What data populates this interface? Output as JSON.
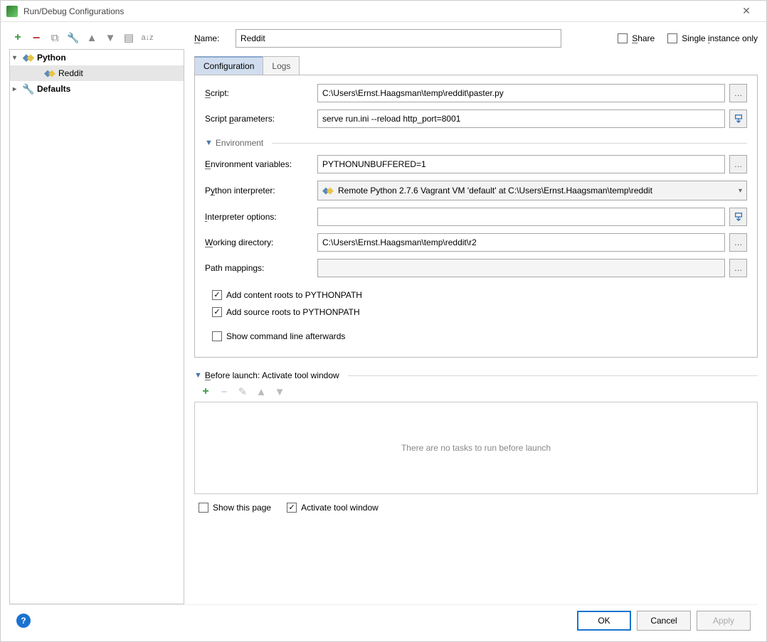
{
  "window": {
    "title": "Run/Debug Configurations"
  },
  "tree": {
    "python": "Python",
    "reddit": "Reddit",
    "defaults": "Defaults"
  },
  "name": {
    "label": "Name:",
    "value": "Reddit"
  },
  "share": {
    "label": "Share",
    "checked": false
  },
  "single": {
    "label": "Single instance only",
    "checked": false
  },
  "tabs": {
    "configuration": "Configuration",
    "logs": "Logs"
  },
  "labels": {
    "script": "Script:",
    "params": "Script parameters:",
    "env_section": "Environment",
    "env_vars": "Environment variables:",
    "interpreter": "Python interpreter:",
    "interp_opts": "Interpreter options:",
    "workdir": "Working directory:",
    "mappings": "Path mappings:",
    "content_roots": "Add content roots to PYTHONPATH",
    "source_roots": "Add source roots to PYTHONPATH",
    "show_cmd": "Show command line afterwards",
    "before": "Before launch: Activate tool window",
    "no_tasks": "There are no tasks to run before launch",
    "show_page": "Show this page",
    "activate_tw": "Activate tool window"
  },
  "values": {
    "script": "C:\\Users\\Ernst.Haagsman\\temp\\reddit\\paster.py",
    "params": "serve run.ini --reload http_port=8001",
    "env_vars": "PYTHONUNBUFFERED=1",
    "interpreter": "Remote Python 2.7.6 Vagrant VM 'default' at C:\\Users\\Ernst.Haagsman\\temp\\reddit",
    "interp_opts": "",
    "workdir": "C:\\Users\\Ernst.Haagsman\\temp\\reddit\\r2",
    "mappings": ""
  },
  "checks": {
    "content_roots": true,
    "source_roots": true,
    "show_cmd": false,
    "show_page": false,
    "activate_tw": true
  },
  "buttons": {
    "ok": "OK",
    "cancel": "Cancel",
    "apply": "Apply"
  }
}
